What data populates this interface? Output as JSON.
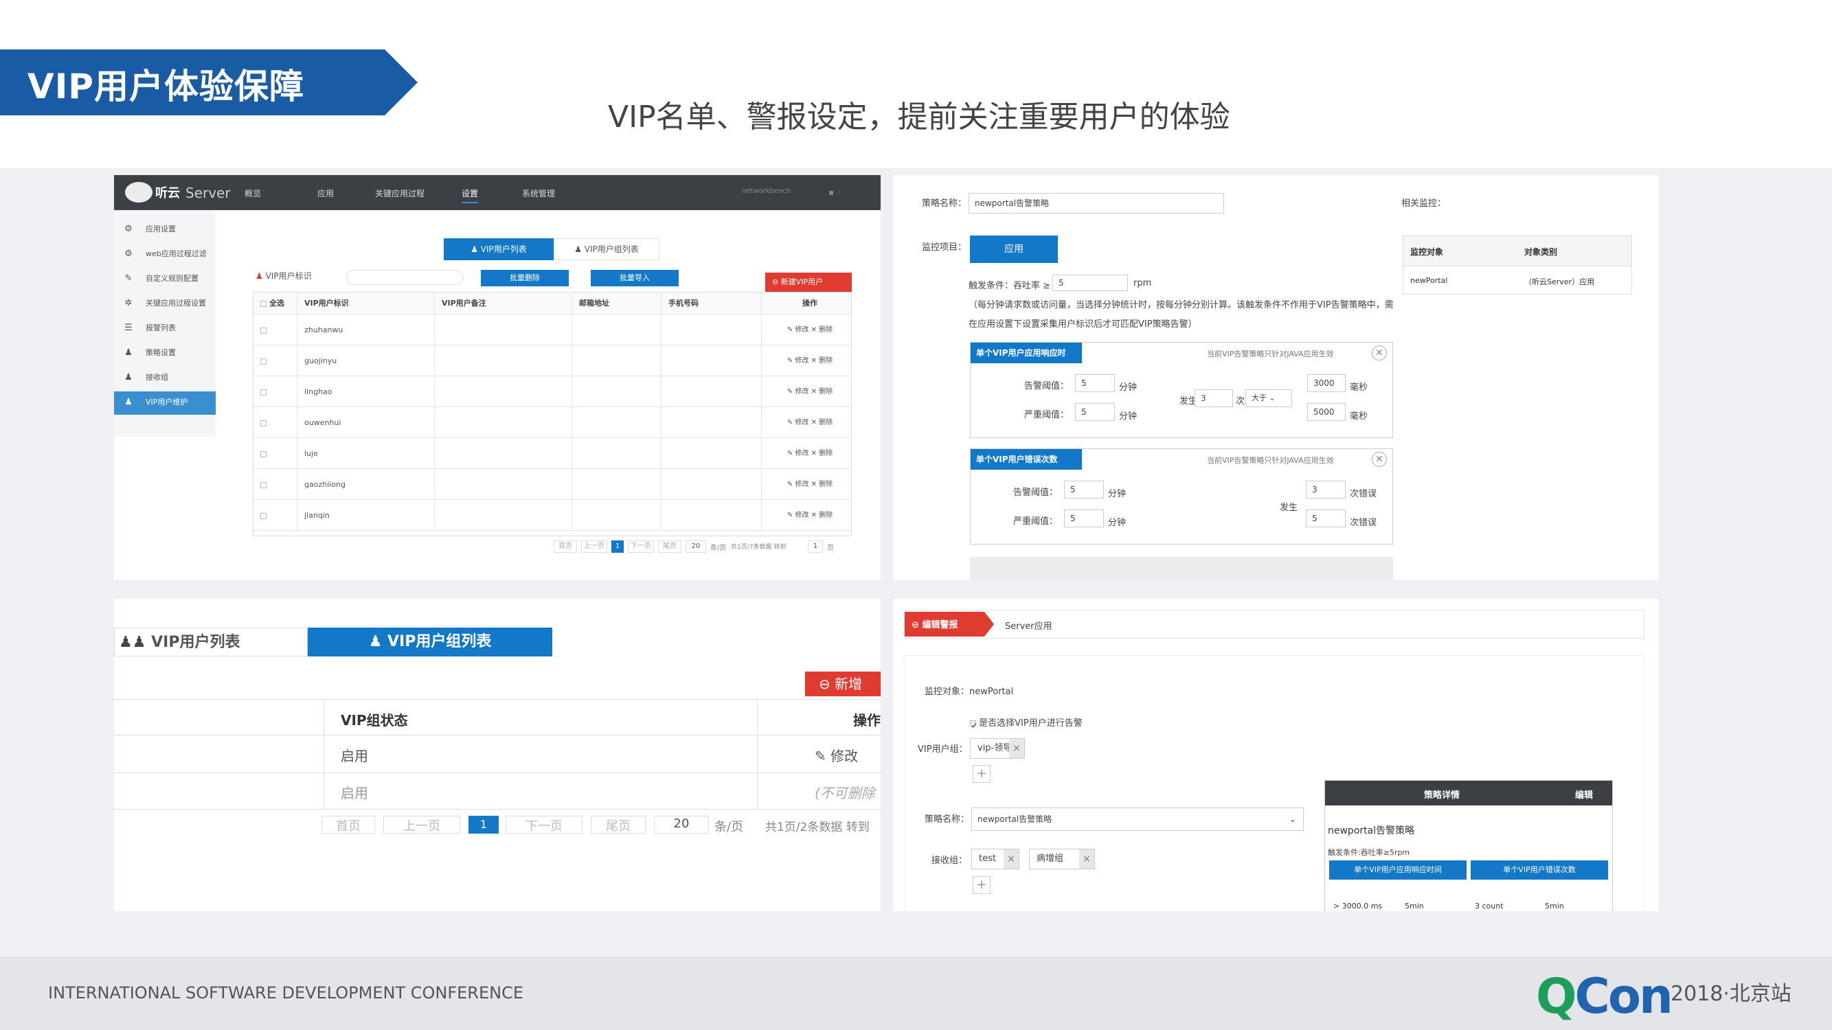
{
  "header": {
    "banner_title": "VIP用户体验保障",
    "subtitle": "VIP名单、警报设定，提前关注重要用户的体验"
  },
  "footer": {
    "conference": "INTERNATIONAL SOFTWARE DEVELOPMENT CONFERENCE",
    "logo_q": "QCon",
    "edition": "2018·北京站"
  },
  "colors": {
    "banner": "#1a5ba6",
    "accent_blue": "#1378c8",
    "danger_red": "#e03b30",
    "qcon_green": "#1c9f5c",
    "qcon_blue": "#2163ae"
  },
  "panel_vip_list": {
    "app": {
      "logo_text": "听云",
      "product": "Server"
    },
    "nav": [
      "概览",
      "应用",
      "关键应用过程",
      "设置",
      "系统管理"
    ],
    "user_name": "networkbench",
    "sidebar": [
      {
        "label": "应用设置",
        "icon": "gear-icon"
      },
      {
        "label": "web应用过程过滤",
        "icon": "gears-icon"
      },
      {
        "label": "自定义规则配置",
        "icon": "wrench-icon"
      },
      {
        "label": "关键应用过程设置",
        "icon": "cog-icon"
      },
      {
        "label": "报警列表",
        "icon": "list-icon"
      },
      {
        "label": "策略设置",
        "icon": "user-icon"
      },
      {
        "label": "接收组",
        "icon": "users-icon"
      },
      {
        "label": "VIP用户维护",
        "icon": "users-icon",
        "active": true
      }
    ],
    "tabs": [
      "VIP用户列表",
      "VIP用户组列表"
    ],
    "vip_label": "VIP用户标识",
    "buttons": {
      "batch_delete": "批量删除",
      "batch_import": "批量导入",
      "new": "新建VIP用户"
    },
    "columns": [
      "全选",
      "VIP用户标识",
      "VIP用户备注",
      "邮箱地址",
      "手机号码",
      "操作"
    ],
    "rows": [
      "zhuhanwu",
      "guojinyu",
      "linghao",
      "ouwenhui",
      "luje",
      "gaozhiiong",
      "jianqin"
    ],
    "row_action": "✎ 修改 ✕ 删除",
    "pager": {
      "first": "首页",
      "prev": "上一页",
      "current": "1",
      "next": "下一页",
      "last": "尾页",
      "size": "20",
      "per_page": "条/页",
      "summary": "共1页/7条数据 转到",
      "goto": "1",
      "page": "页"
    }
  },
  "panel_policy": {
    "policy_name_label": "策略名称：",
    "policy_name": "newportal告警策略",
    "related_label": "相关监控：",
    "monitor_item_label": "监控项目：",
    "monitor_item_btn": "应用",
    "trigger_label": "触发条件：吞吐率 ≥",
    "trigger_value": "5",
    "trigger_unit": "rpm",
    "note_1": "（每分钟请求数或访问量，当选择分钟统计时，按每分钟分别计算。该触发条件不作用于VIP告警策略中，需",
    "note_2": "在应用设置下设置采集用户标识后才可匹配VIP策略告警）",
    "related_table": {
      "headers": [
        "监控对象",
        "对象类别"
      ],
      "row": [
        "newPortal",
        "（听云Server）应用"
      ]
    },
    "box1": {
      "title": "单个VIP用户应用响应时",
      "hint": "当前VIP告警策略只针对JAVA应用生效",
      "warn_label": "告警阈值：",
      "warn_value": "5",
      "crit_label": "严重阈值：",
      "crit_value": "5",
      "minute": "分钟",
      "occur_label": "发生",
      "occur_value": "3",
      "times_label": "次",
      "compare": "大于",
      "ms_warn": "3000",
      "ms_crit": "5000",
      "ms": "毫秒"
    },
    "box2": {
      "title": "单个VIP用户错误次数",
      "hint": "当前VIP告警策略只针对JAVA应用生效",
      "warn_label": "告警阈值：",
      "warn_value": "5",
      "crit_label": "严重阈值：",
      "crit_value": "5",
      "minute": "分钟",
      "occur_label": "发生",
      "err_warn": "3",
      "err_crit": "5",
      "err_unit": "次错误"
    }
  },
  "panel_group": {
    "tabs": [
      "VIP用户列表",
      "VIP用户组列表"
    ],
    "new_btn": "新增",
    "columns": [
      "VIP组状态",
      "操作"
    ],
    "rows": [
      {
        "status": "启用",
        "action": "✎ 修改"
      },
      {
        "status": "启用",
        "action": "(不可删除"
      }
    ],
    "pager": {
      "first": "首页",
      "prev": "上一页",
      "current": "1",
      "next": "下一页",
      "last": "尾页",
      "size": "20",
      "per_page": "条/页",
      "summary": "共1页/2条数据 转到"
    }
  },
  "panel_edit_alert": {
    "tag": "编辑警报",
    "breadcrumb": "Server应用",
    "monitor_object": "监控对象：newPortal",
    "checkbox_label": "是否选择VIP用户进行告警",
    "vip_group_label": "VIP用户组：",
    "vip_group_tag": "vip-领导",
    "policy_label": "策略名称：",
    "policy_value": "newportal告警策略",
    "receiver_label": "接收组：",
    "receivers": [
      "test",
      "病增组"
    ],
    "detail": {
      "header": "策略详情",
      "edit": "编辑",
      "name": "newportal告警策略",
      "trigger": "触发条件:吞吐率≥5rpm",
      "col1": "单个VIP用户应用响应时间",
      "col2": "单个VIP用户错误次数",
      "v1": "> 3000.0 ms",
      "v1b": "5min",
      "v2": "3 count",
      "v2b": "5min"
    }
  }
}
